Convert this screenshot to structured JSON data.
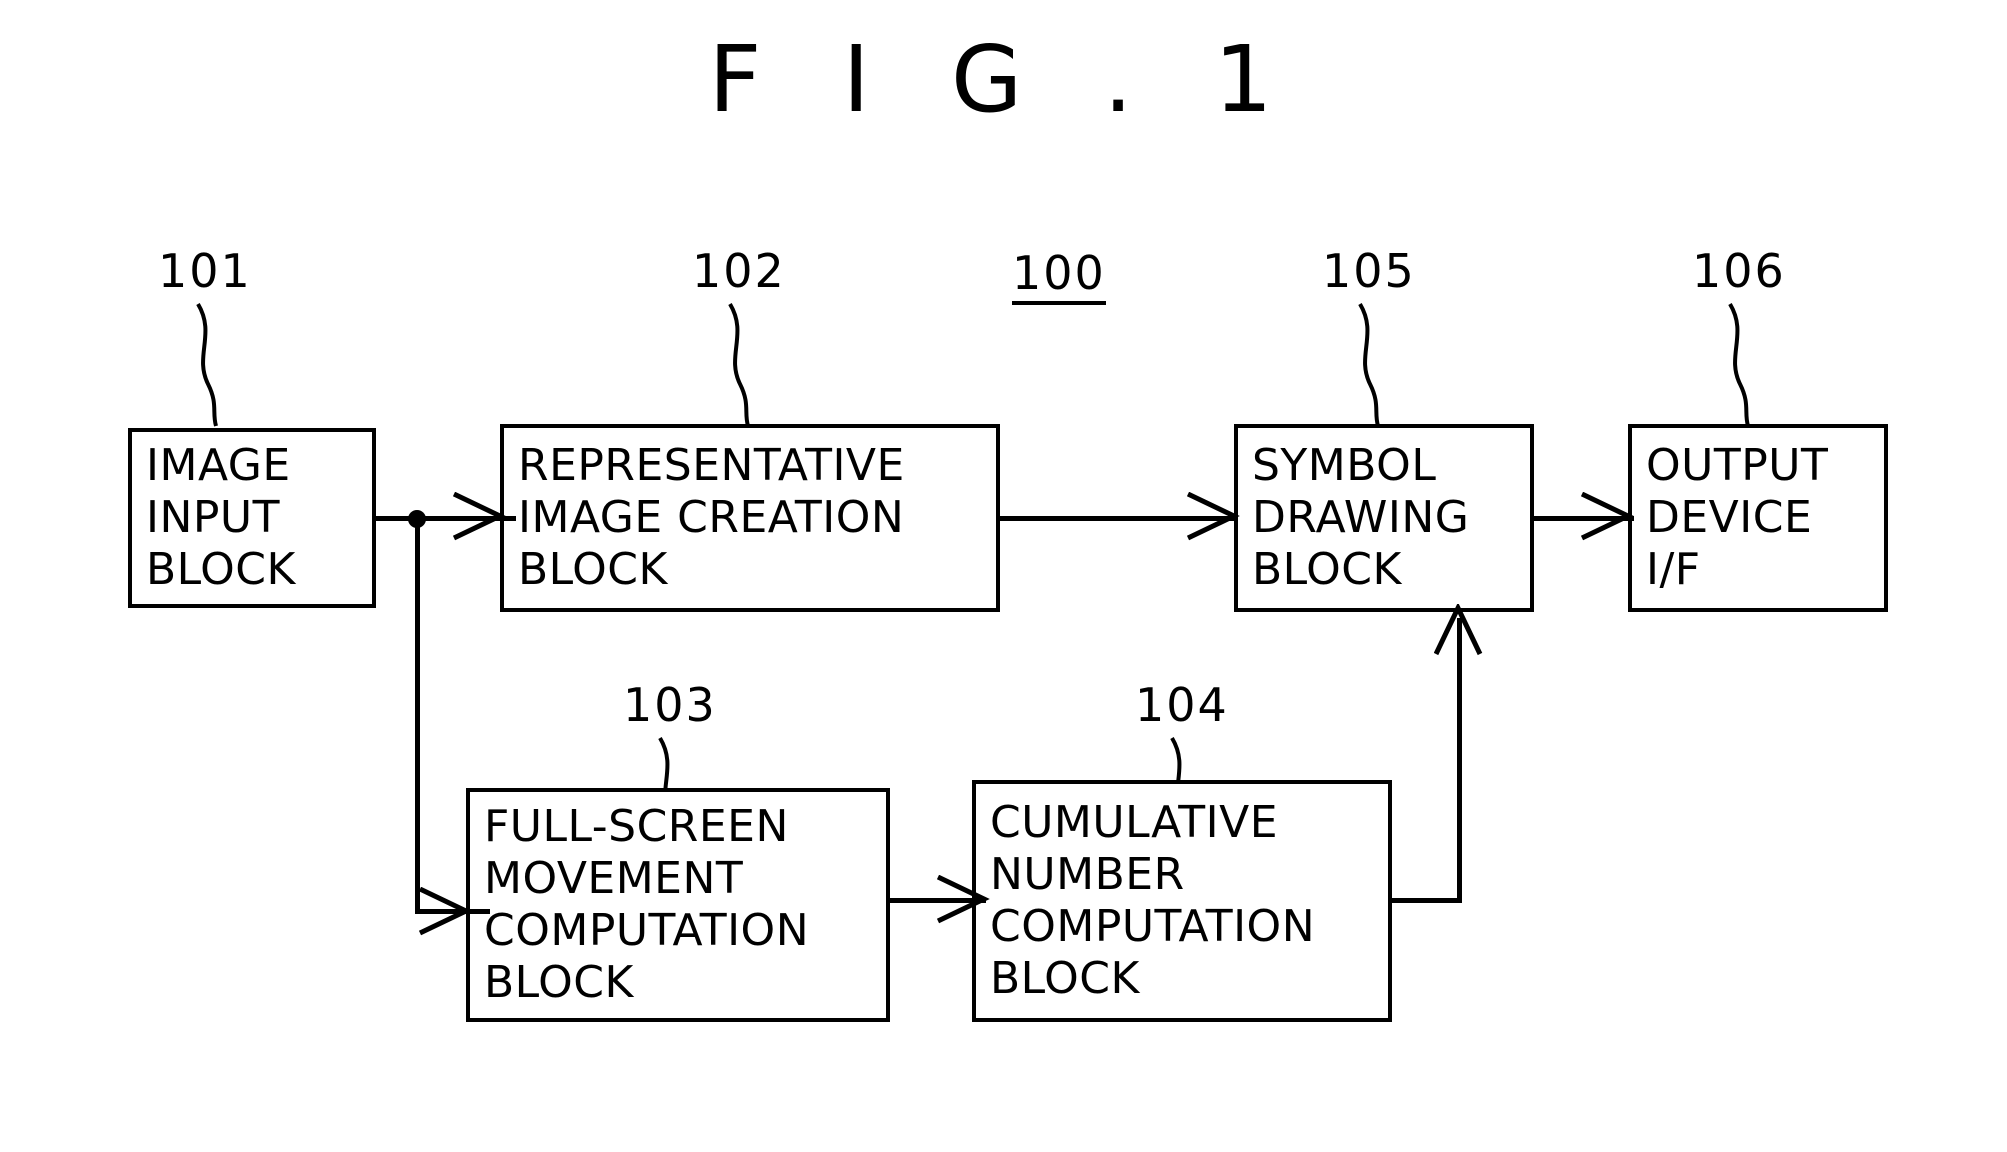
{
  "figure": {
    "title": "F I G . 1",
    "system_label": "100"
  },
  "blocks": [
    {
      "ref": "101",
      "name": "image-input-block",
      "lines": "IMAGE\nINPUT\nBLOCK"
    },
    {
      "ref": "102",
      "name": "representative-image-creation-block",
      "lines": "REPRESENTATIVE\nIMAGE CREATION\nBLOCK"
    },
    {
      "ref": "103",
      "name": "full-screen-movement-computation-block",
      "lines": "FULL-SCREEN\nMOVEMENT\nCOMPUTATION\nBLOCK"
    },
    {
      "ref": "104",
      "name": "cumulative-number-computation-block",
      "lines": "CUMULATIVE\nNUMBER\nCOMPUTATION\nBLOCK"
    },
    {
      "ref": "105",
      "name": "symbol-drawing-block",
      "lines": "SYMBOL\nDRAWING\nBLOCK"
    },
    {
      "ref": "106",
      "name": "output-device-if",
      "lines": "OUTPUT\nDEVICE\nI/F"
    }
  ],
  "colors": {
    "ink": "#000000",
    "paper": "#ffffff"
  }
}
